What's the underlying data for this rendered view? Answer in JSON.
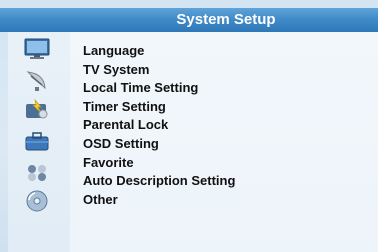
{
  "header": {
    "title": "System Setup"
  },
  "menu": {
    "items": [
      "Language",
      "TV System",
      "Local Time Setting",
      "Timer Setting",
      "Parental Lock",
      "OSD Setting",
      "Favorite",
      "Auto Description Setting",
      "Other"
    ]
  },
  "sidebar": {
    "icons": [
      "tv-monitor-icon",
      "satellite-dish-icon",
      "system-setup-icon",
      "toolbox-icon",
      "games-icon",
      "media-disc-icon"
    ]
  },
  "colors": {
    "title_bar": "#3e89c7",
    "panel_background": "#edf4fa",
    "text": "#111111"
  }
}
